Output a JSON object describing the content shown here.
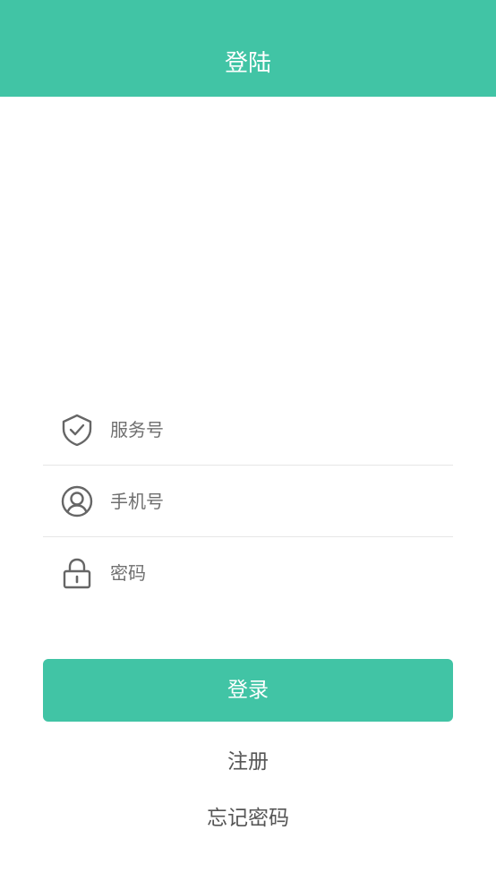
{
  "header": {
    "title": "登陆",
    "background_color": "#41c4a5"
  },
  "form": {
    "service_number": {
      "placeholder": "服务号",
      "value": "",
      "icon": "shield-check-icon"
    },
    "phone": {
      "placeholder": "手机号",
      "value": "",
      "icon": "user-icon"
    },
    "password": {
      "placeholder": "密码",
      "value": "",
      "icon": "lock-icon"
    }
  },
  "actions": {
    "login_label": "登录",
    "register_label": "注册",
    "forgot_password_label": "忘记密码"
  },
  "colors": {
    "accent": "#41c4a5",
    "icon": "#666666",
    "divider": "#e6e6e6"
  }
}
